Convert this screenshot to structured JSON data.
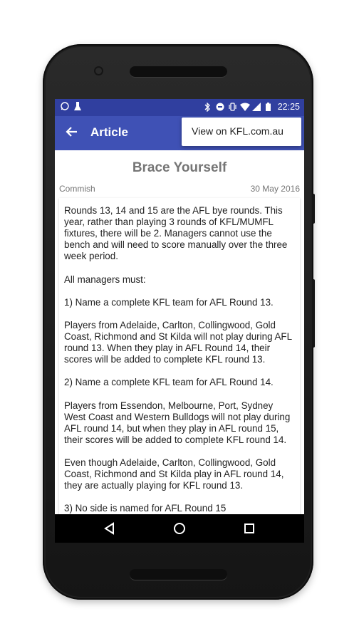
{
  "status_bar": {
    "time": "22:25",
    "left_icons": [
      "whatsapp-icon",
      "debug-icon"
    ],
    "right_icons": [
      "bluetooth-icon",
      "do-not-disturb-icon",
      "vibrate-icon",
      "wifi-icon",
      "signal-icon",
      "battery-icon"
    ]
  },
  "app_bar": {
    "title": "Article",
    "back_icon": "arrow-back-icon"
  },
  "overflow_menu": {
    "items": [
      {
        "label": "View on KFL.com.au"
      }
    ]
  },
  "article": {
    "title": "Brace Yourself",
    "author": "Commish",
    "date": "30 May 2016",
    "paragraphs": [
      "Rounds 13, 14 and 15 are the AFL bye rounds. This year, rather than playing 3 rounds of KFL/MUMFL fixtures, there will be 2. Managers cannot use the bench and will need to score manually over the three week period.",
      "All managers must:",
      "1) Name a complete KFL team for AFL Round 13.",
      "Players from Adelaide, Carlton, Collingwood, Gold Coast, Richmond and St Kilda will not play during AFL round 13. When they play in AFL Round 14, their scores will be added to complete KFL round 13.",
      "2) Name a complete KFL team for AFL Round 14.",
      "Players from Essendon, Melbourne, Port, Sydney West Coast and Western Bulldogs will not play during AFL round 14, but when they play in AFL round 15, their scores will be added to complete KFL round 14.",
      "Even though Adelaide, Carlton, Collingwood, Gold Coast, Richmond and St Kilda play in AFL round 14, they are actually playing for KFL round 13.",
      "3) No side is named for AFL Round 15"
    ]
  },
  "nav_bar": {
    "buttons": [
      "back-triangle-icon",
      "home-circle-icon",
      "recents-square-icon"
    ]
  },
  "colors": {
    "primary": "#3f51b5",
    "primary_dark": "#303f9f",
    "title_gray": "#757575"
  }
}
